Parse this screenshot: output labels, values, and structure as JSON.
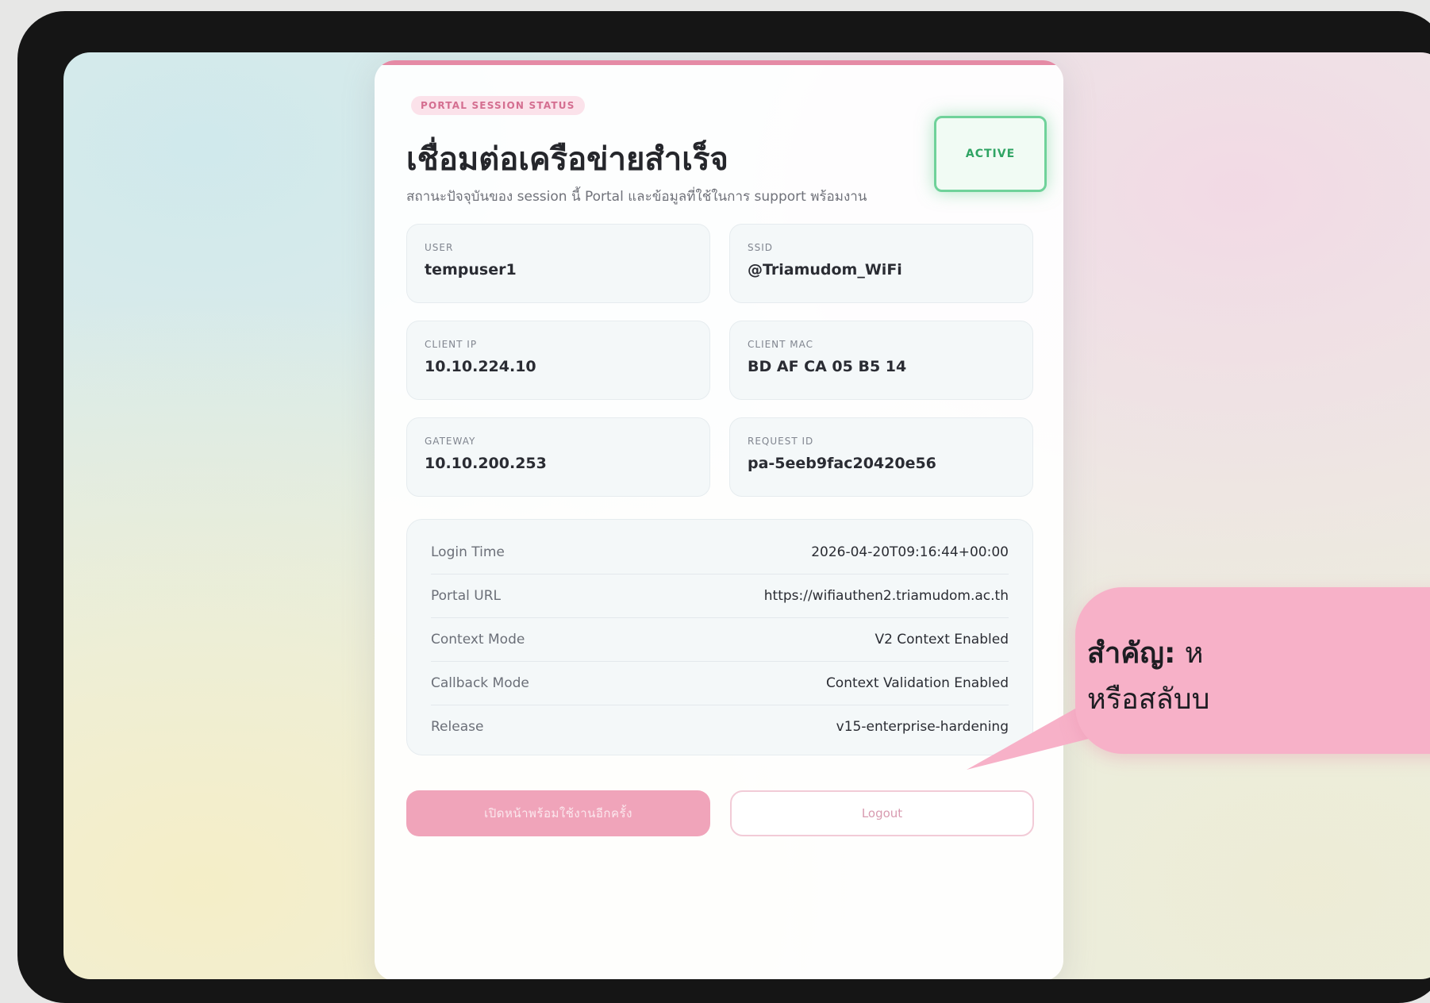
{
  "card": {
    "eyebrow": "PORTAL SESSION STATUS",
    "title": "เชื่อมต่อเครือข่ายสำเร็จ",
    "subtitle": "สถานะปัจจุบันของ session นี้ Portal และข้อมูลที่ใช้ในการ support พร้อมงาน",
    "status": "ACTIVE"
  },
  "tiles": [
    {
      "label": "USER",
      "value": "tempuser1"
    },
    {
      "label": "SSID",
      "value": "@Triamudom_WiFi"
    },
    {
      "label": "CLIENT IP",
      "value": "10.10.224.10"
    },
    {
      "label": "CLIENT MAC",
      "value": "BD AF CA 05 B5 14"
    },
    {
      "label": "GATEWAY",
      "value": "10.10.200.253"
    },
    {
      "label": "REQUEST ID",
      "value": "pa-5eeb9fac20420e56"
    }
  ],
  "details": [
    {
      "key": "Login Time",
      "value": "2026-04-20T09:16:44+00:00"
    },
    {
      "key": "Portal URL",
      "value": "https://wifiauthen2.triamudom.ac.th"
    },
    {
      "key": "Context Mode",
      "value": "V2 Context Enabled"
    },
    {
      "key": "Callback Mode",
      "value": "Context Validation Enabled"
    },
    {
      "key": "Release",
      "value": "v15-enterprise-hardening"
    }
  ],
  "buttons": {
    "primary": "เปิดหน้าพร้อมใช้งานอีกครั้ง",
    "secondary": "Logout"
  },
  "callout": {
    "strong": "สำคัญ:",
    "line1": "ห",
    "line2": "หรือสลับบ"
  },
  "colors": {
    "accent": "#e58aa5",
    "active": "#2fa463",
    "callout": "#f7b1c8"
  }
}
